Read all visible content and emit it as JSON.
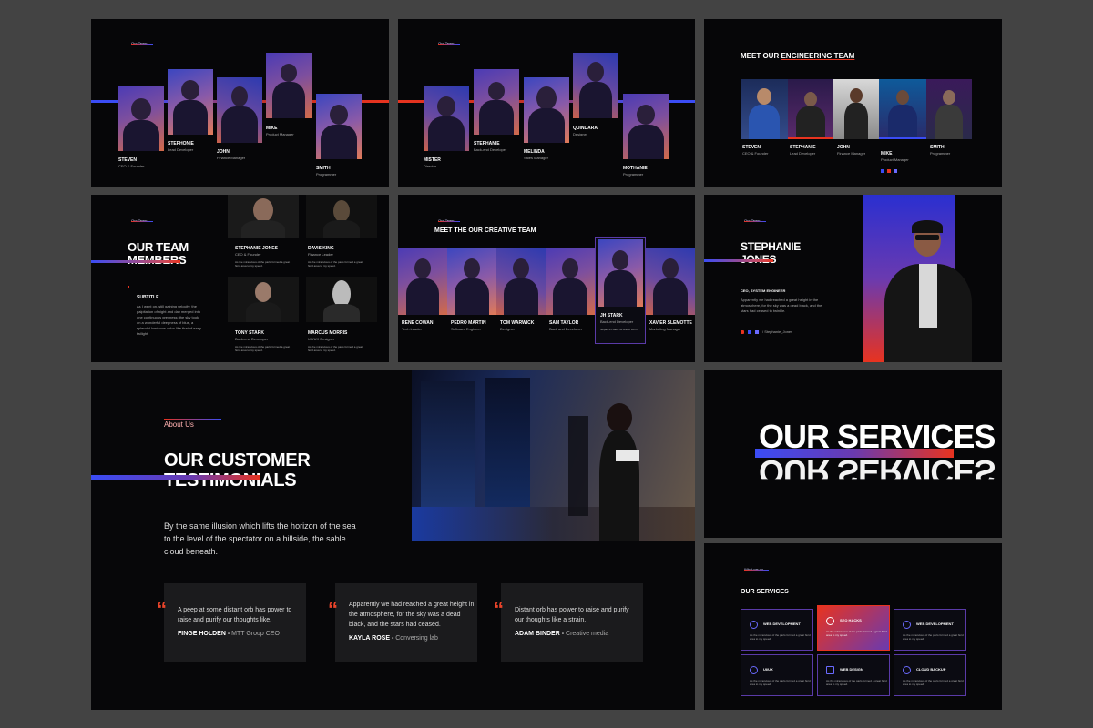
{
  "slide1": {
    "tag": "Our Team",
    "members": [
      {
        "name": "STEVEN",
        "role": "CEO & Founder"
      },
      {
        "name": "STEPHONIE",
        "role": "Lead Developer"
      },
      {
        "name": "JOHN",
        "role": "Finance Manager"
      },
      {
        "name": "MIKE",
        "role": "Product Manager"
      },
      {
        "name": "SMITH",
        "role": "Programmer"
      }
    ]
  },
  "slide2": {
    "tag": "Our Team",
    "members": [
      {
        "name": "MISTER",
        "role": "Director"
      },
      {
        "name": "STEPHANIE",
        "role": "Back-end Developer"
      },
      {
        "name": "MELINDA",
        "role": "Sales Manager"
      },
      {
        "name": "QUINDARA",
        "role": "Designer"
      },
      {
        "name": "MOTHANIE",
        "role": "Programmer"
      }
    ]
  },
  "slide3": {
    "title_a": "MEET OUR ",
    "title_b": "ENGINEERING TEAM",
    "members": [
      {
        "name": "STEVEN",
        "role": "CEO & Founder"
      },
      {
        "name": "STEPHANIE",
        "role": "Lead Developer"
      },
      {
        "name": "JOHN",
        "role": "Finance Manager"
      },
      {
        "name": "MIKE",
        "role": "Product Manager"
      },
      {
        "name": "SMITH",
        "role": "Programmer"
      }
    ]
  },
  "slide4": {
    "tag": "Our Team",
    "title_1": "OUR TEAM",
    "title_2": "MEMBERS",
    "subtitle": "SUBTITLE",
    "body": "As I went on, still gaining velocity, the palpitation of night and day merged into one continuous greyness; the sky took on a wonderful deepness of blue, a splendid luminous color like that of early twilight.",
    "members": [
      {
        "name": "STEPHANIE JONES",
        "role": "CEO & Founder",
        "desc": "As the miraculous of the parts formed a great fiord area to my speed."
      },
      {
        "name": "DAVIS KING",
        "role": "Finance Leader",
        "desc": "As the miraculous of the parts formed a great fiord area to my speed."
      },
      {
        "name": "TONY STARK",
        "role": "Back-end Developer",
        "desc": "As the miraculous of the parts formed a great fiord area to my speed."
      },
      {
        "name": "MARCUS MORRIS",
        "role": "UX/UX Designer",
        "desc": "As the miraculous of the parts formed a great fiord area to my speed."
      }
    ]
  },
  "slide5": {
    "tag": "Our Team",
    "title": "MEET THE OUR CREATIVE TEAM",
    "members": [
      {
        "name": "RENE COWAN",
        "role": "Tech Leader"
      },
      {
        "name": "PEDRO MARTIN",
        "role": "Software Engineer"
      },
      {
        "name": "TOM WARWICK",
        "role": "Designer"
      },
      {
        "name": "SAM TAYLOR",
        "role": "Back and Developer"
      },
      {
        "name": "JH STARK",
        "role": "Back-end Developer",
        "extra": "Nepal, 25 Baby ist Radio Lorm"
      },
      {
        "name": "XAVIER SLEMOTTE",
        "role": "Marketing Manager"
      }
    ]
  },
  "slide6": {
    "tag": "Our Team",
    "name_1": "STEPHANIE",
    "name_2": "JONES",
    "role": "CEO, SYSTEM ENGINEER",
    "body": "Apparently we had reached a great height in the atmosphere, for the sky was a dead black, and the stars had ceased to twinkle.",
    "handle": "/ Stephanie_Jones"
  },
  "slide7": {
    "tag": "About Us",
    "title_1": "OUR CUSTOMER",
    "title_2": "TESTIMONIALS",
    "intro": "By the same illusion which lifts the horizon of the sea to the level of the spectator on a hillside, the sable cloud beneath.",
    "quotes": [
      {
        "text": "A peep at some distant orb has power to raise and purify our thoughts like.",
        "author": "FINGE HOLDEN",
        "org": "MTT Group CEO"
      },
      {
        "text": "Apparently we had reached a great height in the atmosphere, for the sky was a dead black, and the stars had ceased.",
        "author": "KAYLA ROSE",
        "org": "Conversing lab"
      },
      {
        "text": "Distant orb has power to raise and purify our thoughts like a strain.",
        "author": "ADAM BINDER",
        "org": "Creative media"
      }
    ]
  },
  "slide8": {
    "title": "OUR SERVICES"
  },
  "slide9": {
    "tag": "What we do",
    "title": "OUR SERVICES",
    "services": [
      {
        "title": "WEB DEVELOPMENT",
        "desc": "As the miraculous of the parts formed a great fiord area to my speed."
      },
      {
        "title": "SEO HACKS",
        "desc": "As the miraculous of the parts formed a great fiord area to my speed."
      },
      {
        "title": "WEB DEVELOPMENT",
        "desc": "As the miraculous of the parts formed a great fiord area to my speed."
      },
      {
        "title": "UI/UX",
        "desc": "As the miraculous of the parts formed a great fiord area to my speed."
      },
      {
        "title": "WEB DESIGN",
        "desc": "As the miraculous of the parts formed a great fiord area to my speed."
      },
      {
        "title": "CLOUD BACKUP",
        "desc": "As the miraculous of the parts formed a great fiord area to my speed."
      }
    ]
  },
  "colors": {
    "accent_red": "#e8331f",
    "accent_blue": "#3a4cf5",
    "background": "#434343",
    "slide": "#060608"
  }
}
